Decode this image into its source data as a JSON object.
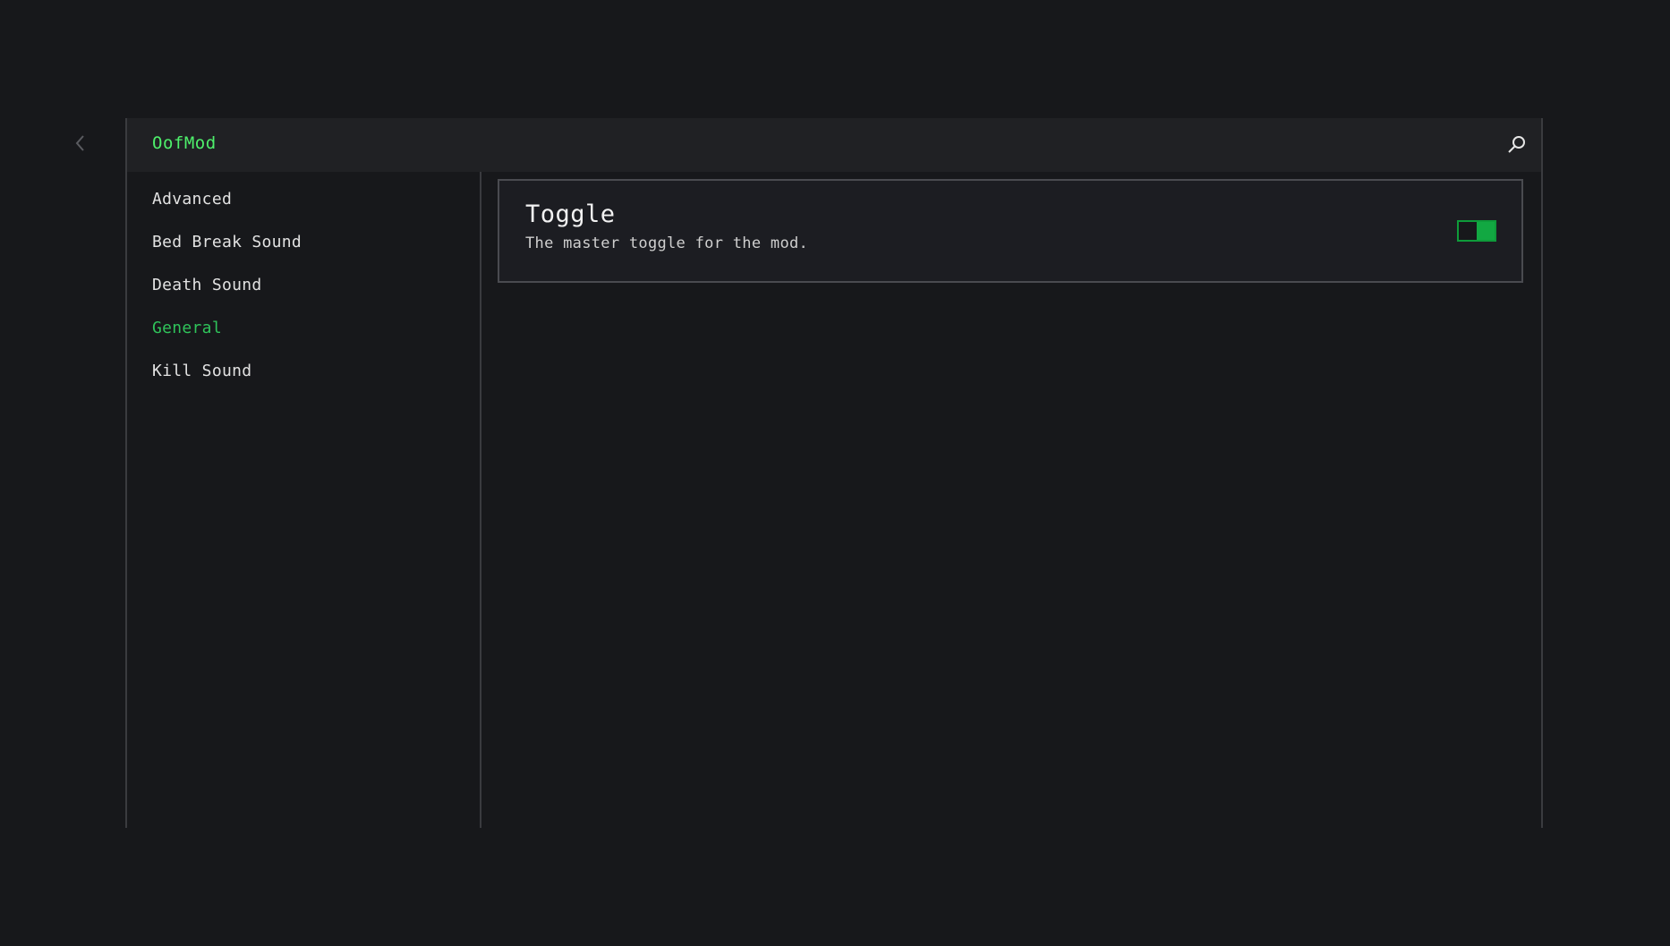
{
  "app": {
    "title": "OofMod"
  },
  "icons": {
    "back": "chevron-left-icon",
    "search": "search-icon"
  },
  "colors": {
    "accent": "#2fc35a",
    "title_accent": "#4ef06b",
    "toggle_on": "#12a842",
    "background": "#17181b"
  },
  "sidebar": {
    "items": [
      {
        "label": "Advanced",
        "active": false
      },
      {
        "label": "Bed Break Sound",
        "active": false
      },
      {
        "label": "Death Sound",
        "active": false
      },
      {
        "label": "General",
        "active": true
      },
      {
        "label": "Kill Sound",
        "active": false
      }
    ]
  },
  "settings": [
    {
      "title": "Toggle",
      "description": "The master toggle for the mod.",
      "enabled": true
    }
  ]
}
